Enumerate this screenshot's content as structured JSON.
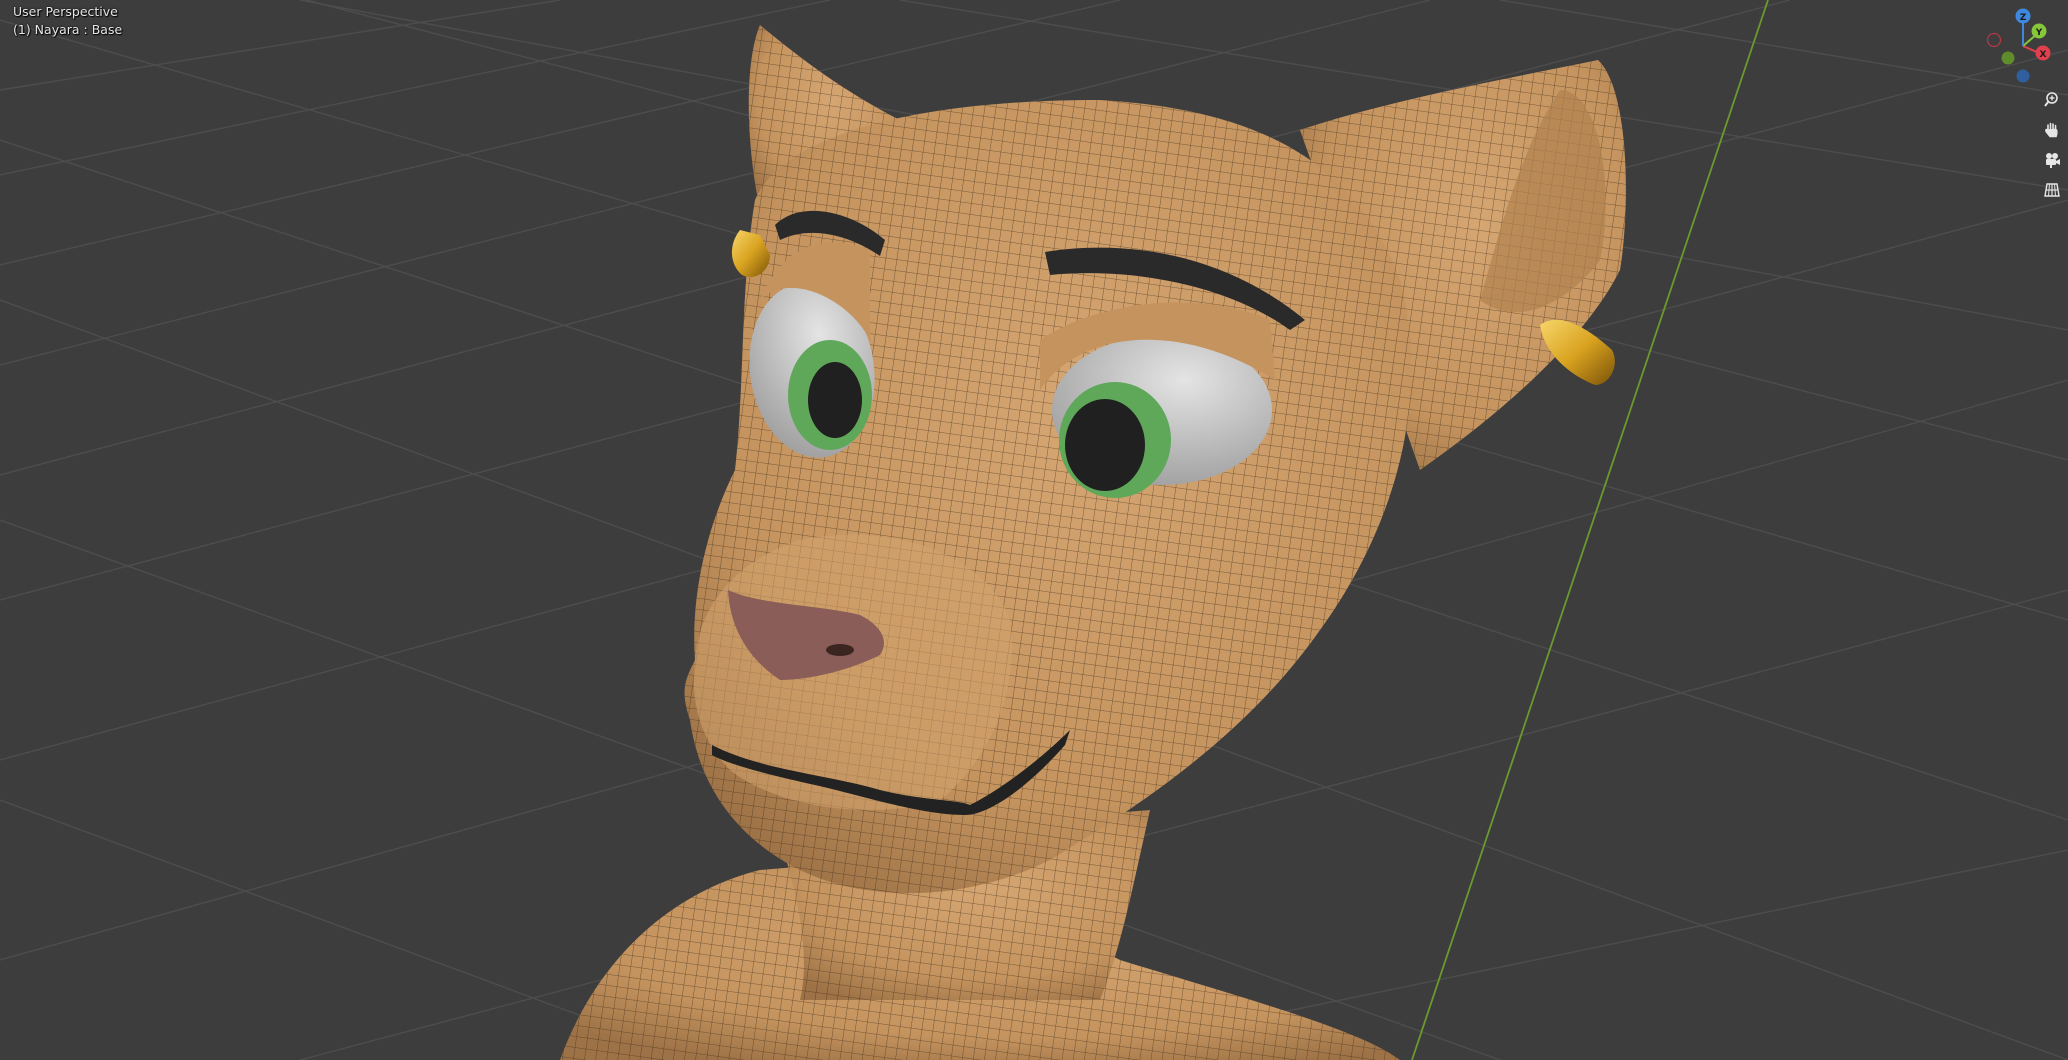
{
  "viewport": {
    "view_name": "User Perspective",
    "object_name": "(1) Nayara : Base",
    "background_color": "#3d3d3d",
    "grid_color": "#4d4d4d",
    "y_axis_color": "#6a9a2e"
  },
  "model": {
    "skin_color": "#c4935e",
    "wire_color": "#3a2a18",
    "nose_color": "#8a5d58",
    "iris_color": "#5fa85a",
    "pupil_color": "#202020",
    "eye_white_color": "#c9c9c9",
    "earring_color": "#d9a320",
    "brow_color": "#2a2a2a"
  },
  "gizmo": {
    "z_label": "Z",
    "y_label": "Y",
    "x_label": "X",
    "x_color": "#e0404e",
    "y_color": "#86c63a",
    "z_color": "#3f88e0"
  },
  "nav_buttons": [
    {
      "name": "zoom",
      "icon": "magnifier-plus-icon"
    },
    {
      "name": "pan",
      "icon": "hand-icon"
    },
    {
      "name": "camera",
      "icon": "camera-icon"
    },
    {
      "name": "ortho",
      "icon": "grid-icon"
    }
  ]
}
